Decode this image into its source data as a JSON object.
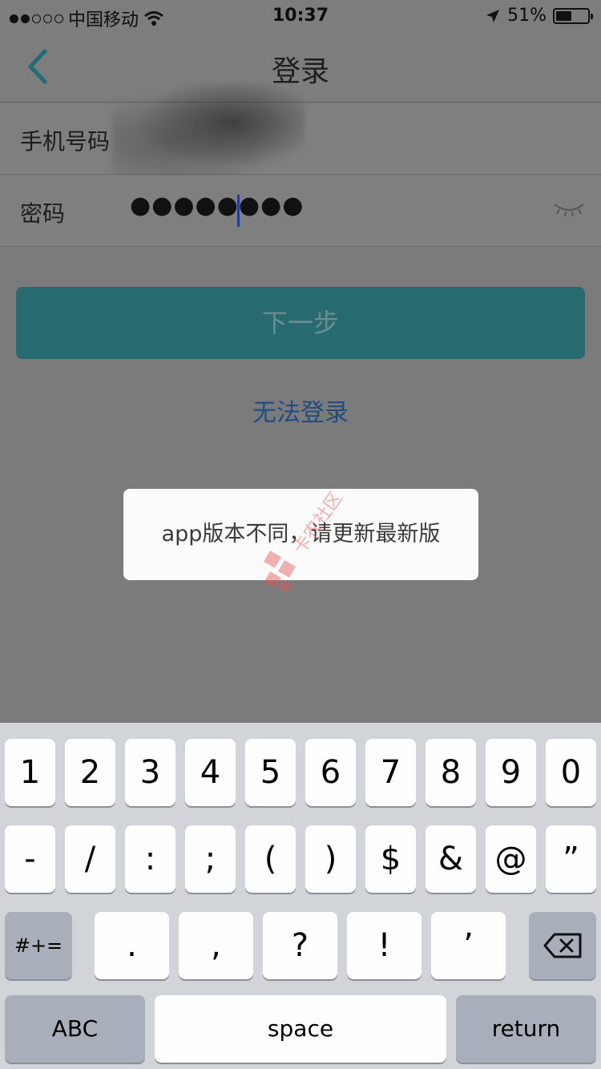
{
  "status_bar": {
    "carrier": "中国移动",
    "time": "10:37",
    "battery_percent": "51%",
    "battery_level": 0.51,
    "signal_bars_filled": 2,
    "signal_bars_total": 5,
    "icons": [
      "wifi-icon",
      "location-arrow-icon",
      "battery-icon"
    ]
  },
  "nav": {
    "title": "登录",
    "back_icon": "chevron-left-icon"
  },
  "form": {
    "phone_label": "手机号码",
    "password_label": "密码",
    "password_mask": "●●●●●●●●",
    "eye_icon": "eye-closed-icon"
  },
  "actions": {
    "next_label": "下一步",
    "cant_login_label": "无法登录"
  },
  "toast": {
    "message": "app版本不同，请更新最新版"
  },
  "keyboard": {
    "row1": [
      "1",
      "2",
      "3",
      "4",
      "5",
      "6",
      "7",
      "8",
      "9",
      "0"
    ],
    "row2": [
      "-",
      "/",
      ":",
      ";",
      "(",
      ")",
      "$",
      "&",
      "@",
      "”"
    ],
    "row3_left": "#+=",
    "row3": [
      ".",
      ",",
      "?",
      "!",
      "’"
    ],
    "delete_icon": "backspace-icon",
    "abc_label": "ABC",
    "space_label": "space",
    "return_label": "return"
  },
  "colors": {
    "accent_teal": "#276a70",
    "link_blue": "#1f4d80",
    "caret_blue": "#1c3f9c"
  }
}
